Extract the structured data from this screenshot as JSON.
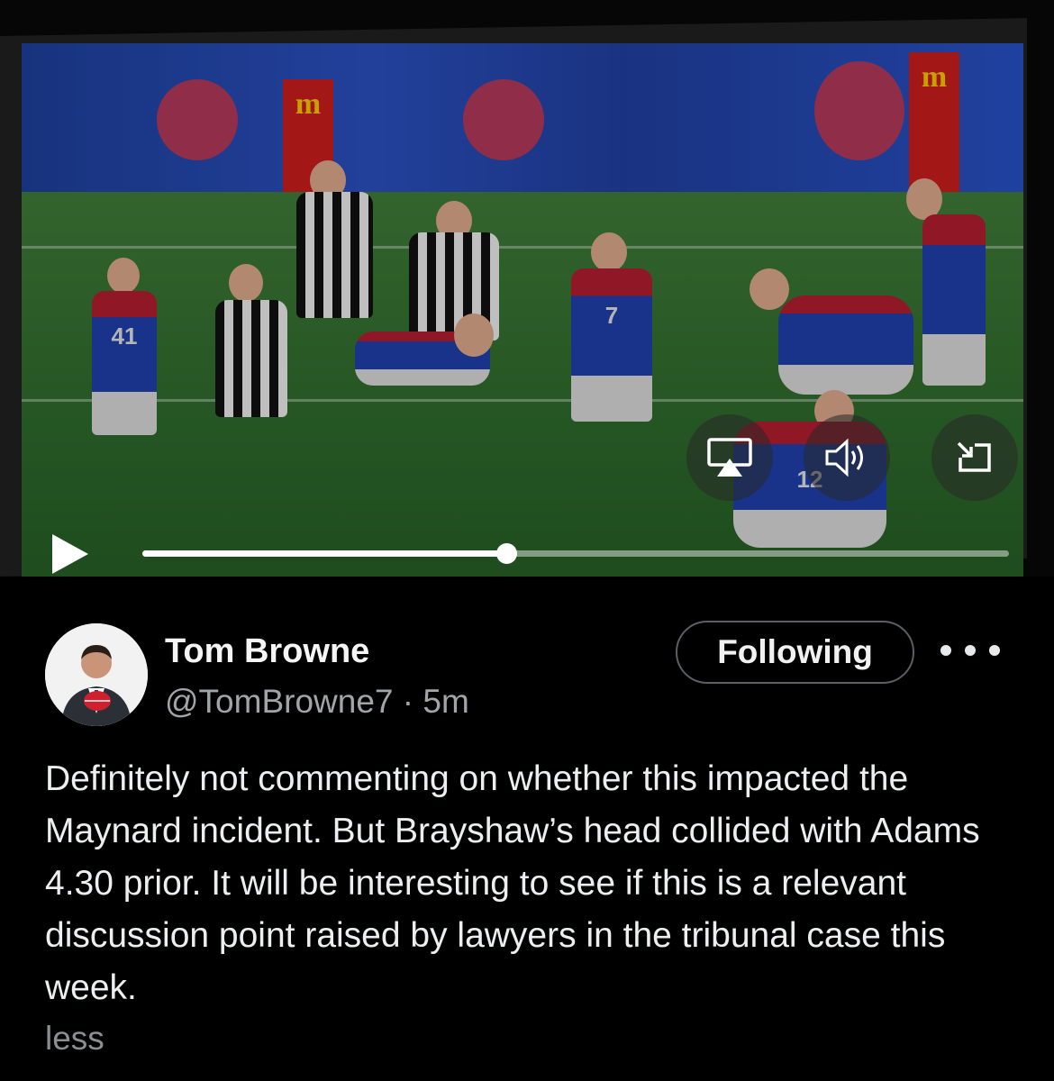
{
  "video": {
    "progress_fraction": 0.42,
    "controls": {
      "play_icon": "play-icon",
      "airplay_icon": "airplay-icon",
      "volume_icon": "volume-icon",
      "minimize_icon": "minimize-icon"
    },
    "scene": {
      "jersey_numbers": [
        "41",
        "7",
        "12"
      ],
      "sponsor_letter": "m"
    }
  },
  "tweet": {
    "author": {
      "name": "Tom Browne",
      "handle_time": "@TomBrowne7 · 5m"
    },
    "follow_label": "Following",
    "more_icon": "more-dots-icon",
    "body": "Definitely not commenting on whether this impacted the Maynard incident. But Brayshaw’s head collided with Adams 4.30 prior. It will be interesting to see if this is a relevant discussion point raised by lawyers in the tribunal case this week.",
    "less_label": "less"
  },
  "colors": {
    "background": "#000000",
    "text_primary": "#e7e9ea",
    "text_secondary": "#a2a5a8",
    "button_border": "#5a5f63"
  }
}
